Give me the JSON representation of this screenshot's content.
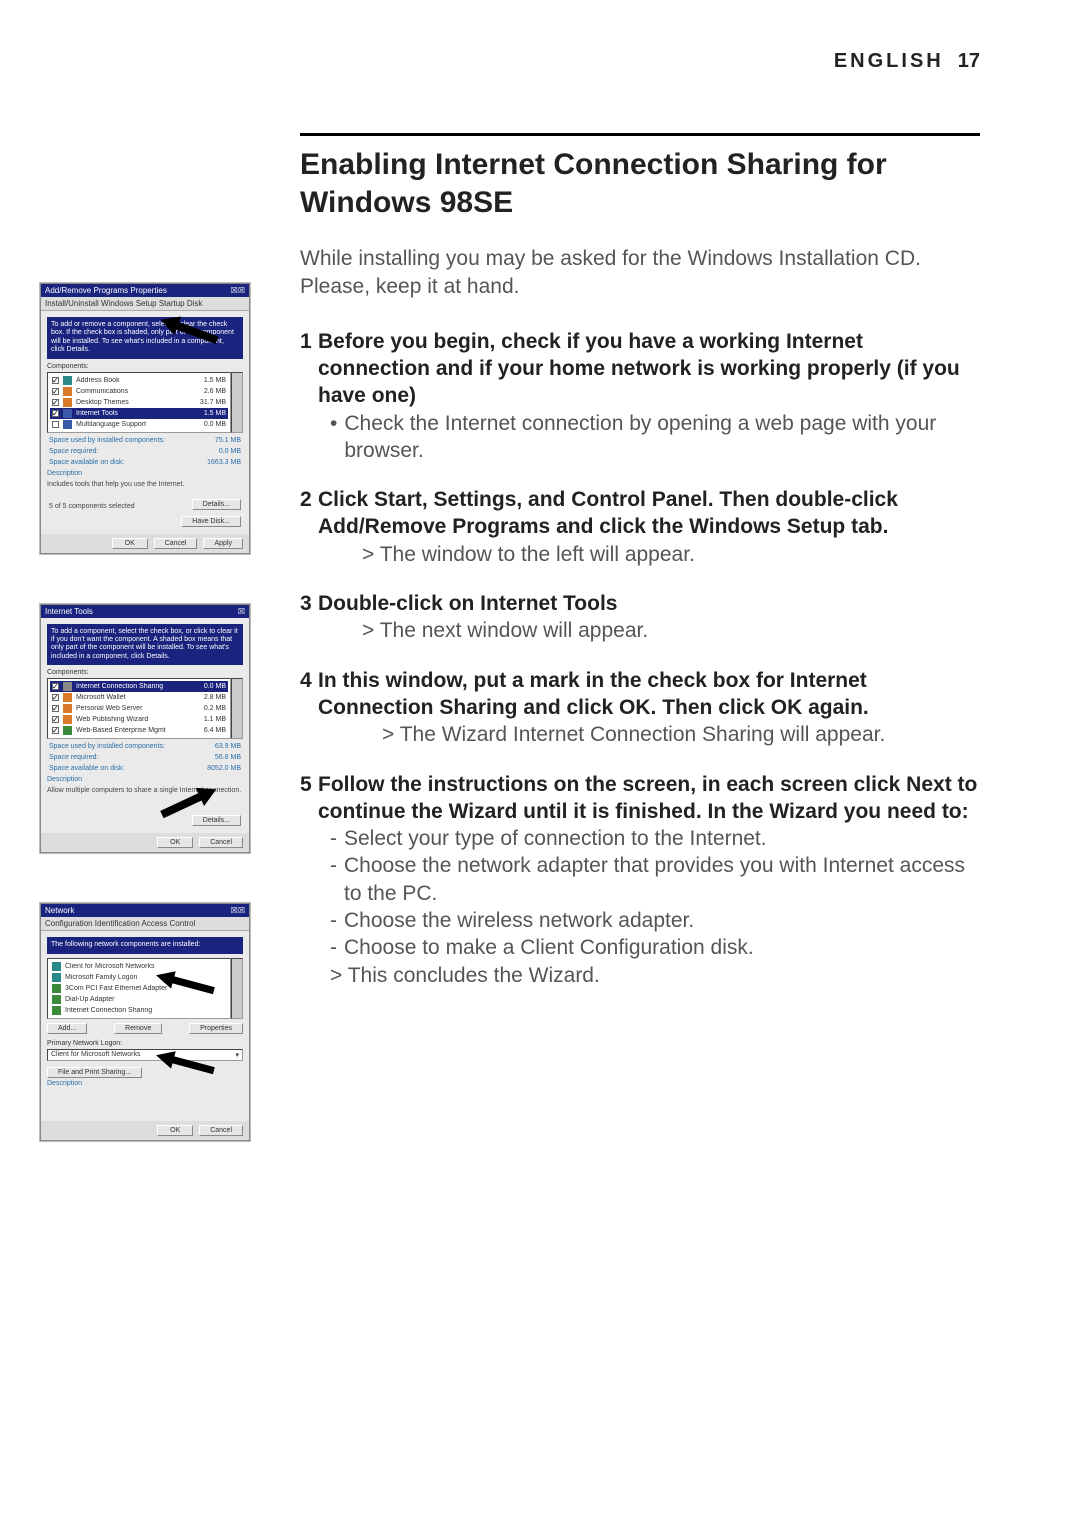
{
  "header": {
    "label": "ENGLISH",
    "page": "17"
  },
  "title": "Enabling Internet Connection Sharing for Windows 98SE",
  "intro": "While installing you may be asked for the Windows Installation CD. Please, keep it at hand.",
  "steps": [
    {
      "num": "1",
      "title": "Before you begin, check if you have a working Internet connection and if your home network is working properly (if you have one)",
      "subs": [
        {
          "type": "bullet",
          "text": "Check the Internet connection by opening a web page with your browser."
        }
      ]
    },
    {
      "num": "2",
      "title": "Click Start, Settings, and Control Panel. Then double-click Add/Remove Programs and click the Windows Setup tab.",
      "subs": [
        {
          "type": "gt",
          "text": "The window to the left will appear."
        }
      ]
    },
    {
      "num": "3",
      "title": "Double-click on Internet Tools",
      "subs": [
        {
          "type": "gt",
          "text": "The next window will appear."
        }
      ]
    },
    {
      "num": "4",
      "title": "In this window, put a mark in the check box for Internet Connection Sharing and click OK. Then click OK again.",
      "subs": [
        {
          "type": "gt",
          "indent": true,
          "text": "The Wizard Internet Connection Sharing will appear."
        }
      ]
    },
    {
      "num": "5",
      "title": "Follow the instructions on the screen, in each screen click Next to continue the Wizard until it is finished. In the Wizard you need to:",
      "subs": [
        {
          "type": "dash",
          "text": "Select your type of connection to the Internet."
        },
        {
          "type": "dash",
          "text": "Choose the network adapter that provides you with Internet access to the PC."
        },
        {
          "type": "dash",
          "text": "Choose the wireless network adapter."
        },
        {
          "type": "dash",
          "text": "Choose to make a Client Configuration disk."
        },
        {
          "type": "gt",
          "text": "This concludes the Wizard."
        }
      ]
    }
  ],
  "thumb1": {
    "title": "Add/Remove Programs Properties",
    "tabs": "Install/Uninstall    Windows Setup    Startup Disk",
    "instruction": "To add or remove a component, select or clear the check box. If the check box is shaded, only part of the component will be installed. To see what's included in a component, click Details.",
    "components_label": "Components:",
    "rows": [
      {
        "checked": true,
        "icon": "teal",
        "name": "Address Book",
        "size": "1.5 MB"
      },
      {
        "checked": true,
        "icon": "orange",
        "name": "Communications",
        "size": "2.6 MB"
      },
      {
        "checked": true,
        "icon": "orange",
        "name": "Desktop Themes",
        "size": "31.7 MB"
      },
      {
        "checked": true,
        "icon": "blue",
        "name": "Internet Tools",
        "size": "1.5 MB",
        "selected": true
      },
      {
        "checked": false,
        "icon": "blue",
        "name": "Multilanguage Support",
        "size": "0.0 MB"
      }
    ],
    "stats": [
      {
        "label": "Space used by installed components:",
        "value": "75.1 MB"
      },
      {
        "label": "Space required:",
        "value": "0.0 MB"
      },
      {
        "label": "Space available on disk:",
        "value": "1663.3 MB"
      }
    ],
    "desc_label": "Description",
    "desc_text": "Includes tools that help you use the Internet.",
    "count": "5 of 5 components selected",
    "details_btn": "Details...",
    "havedisk_btn": "Have Disk...",
    "ok": "OK",
    "cancel": "Cancel",
    "apply": "Apply"
  },
  "thumb2": {
    "title": "Internet Tools",
    "instruction": "To add a component, select the check box, or click to clear it if you don't want the component. A shaded box means that only part of the component will be installed. To see what's included in a component, click Details.",
    "components_label": "Components:",
    "rows": [
      {
        "checked": true,
        "icon": "gray",
        "name": "Internet Connection Sharing",
        "size": "0.0 MB",
        "selected": true
      },
      {
        "checked": true,
        "icon": "orange",
        "name": "Microsoft Wallet",
        "size": "2.8 MB"
      },
      {
        "checked": true,
        "icon": "orange",
        "name": "Personal Web Server",
        "size": "0.2 MB"
      },
      {
        "checked": true,
        "icon": "orange",
        "name": "Web Publishing Wizard",
        "size": "1.1 MB"
      },
      {
        "checked": true,
        "icon": "green",
        "name": "Web-Based Enterprise Mgmt",
        "size": "6.4 MB"
      }
    ],
    "stats": [
      {
        "label": "Space used by installed components:",
        "value": "63.9 MB"
      },
      {
        "label": "Space required:",
        "value": "56.8 MB"
      },
      {
        "label": "Space available on disk:",
        "value": "8052.0 MB"
      }
    ],
    "desc_label": "Description",
    "desc_text": "Allow multiple computers to share a single Internet connection.",
    "details_btn": "Details...",
    "ok": "OK",
    "cancel": "Cancel"
  },
  "thumb3": {
    "title": "Network",
    "tabs": "Configuration    Identification    Access Control",
    "list_label": "The following network components are installed:",
    "rows": [
      {
        "icon": "teal",
        "name": "Client for Microsoft Networks"
      },
      {
        "icon": "teal",
        "name": "Microsoft Family Logon"
      },
      {
        "icon": "green",
        "name": "3Com PCI Fast Ethernet Adapter"
      },
      {
        "icon": "green",
        "name": "Dial-Up Adapter"
      },
      {
        "icon": "green",
        "name": "Internet Connection Sharing"
      }
    ],
    "add_btn": "Add...",
    "remove_btn": "Remove",
    "properties_btn": "Properties",
    "logon_label": "Primary Network Logon:",
    "logon_value": "Client for Microsoft Networks",
    "fileshare_btn": "File and Print Sharing...",
    "desc_label": "Description",
    "ok": "OK",
    "cancel": "Cancel"
  }
}
